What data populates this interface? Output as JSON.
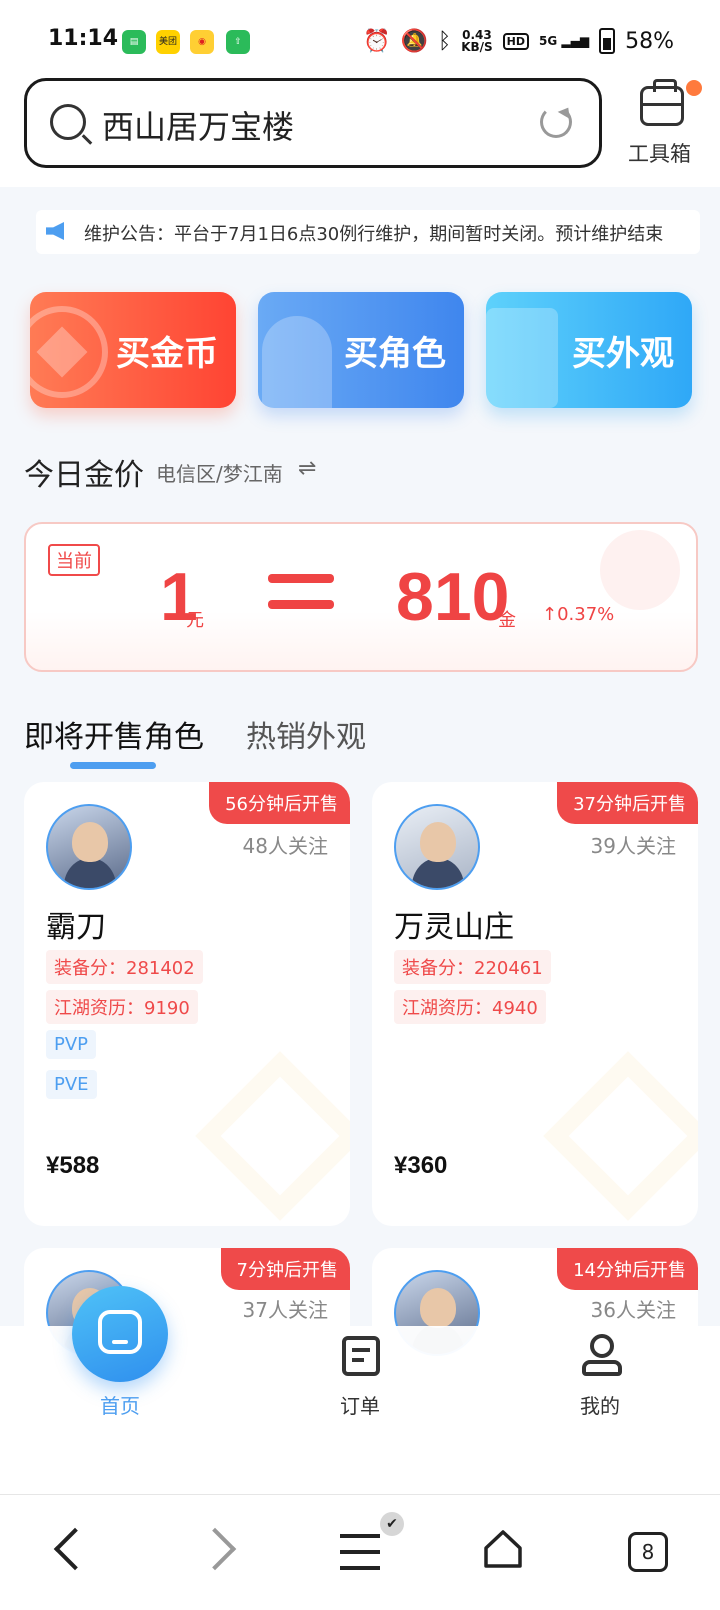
{
  "status_bar": {
    "time": "11:14",
    "network_speed": "0.43",
    "network_unit": "KB/S",
    "hd": "HD",
    "signal": "5G",
    "battery": "58%",
    "app_badges": [
      "美团"
    ]
  },
  "header": {
    "search_text": "西山居万宝楼",
    "toolbox_label": "工具箱"
  },
  "notice": {
    "text": "维护公告：平台于7月1日6点30例行维护，期间暂时关闭。预计维护结束"
  },
  "categories": [
    {
      "label": "买金币"
    },
    {
      "label": "买角色"
    },
    {
      "label": "买外观"
    }
  ],
  "gold_price": {
    "title": "今日金价",
    "region": "电信区/梦江南",
    "swap_icon": "⇌",
    "badge": "当前",
    "yuan_value": "1",
    "yuan_unit": "元",
    "gold_value": "810",
    "gold_unit": "金",
    "change": "↑0.37%"
  },
  "tabs": [
    {
      "label": "即将开售角色",
      "active": true
    },
    {
      "label": "热销外观",
      "active": false
    }
  ],
  "role_cards": [
    {
      "sale_tag": "56分钟后开售",
      "watchers": "48人关注",
      "name": "霸刀",
      "tags_red": [
        "装备分：281402",
        "江湖资历：9190"
      ],
      "tags_blue": [
        "PVP",
        "PVE"
      ],
      "price": "¥588"
    },
    {
      "sale_tag": "37分钟后开售",
      "watchers": "39人关注",
      "name": "万灵山庄",
      "tags_red": [
        "装备分：220461",
        "江湖资历：4940"
      ],
      "tags_blue": [],
      "price": "¥360"
    },
    {
      "sale_tag": "7分钟后开售",
      "watchers": "37人关注"
    },
    {
      "sale_tag": "14分钟后开售",
      "watchers": "36人关注"
    }
  ],
  "bottom_nav": [
    {
      "label": "首页",
      "icon": "home-icon",
      "active": true
    },
    {
      "label": "订单",
      "icon": "order-icon",
      "active": false
    },
    {
      "label": "我的",
      "icon": "profile-icon",
      "active": false
    }
  ],
  "system_nav": {
    "tab_count": "8",
    "menu_badge": "✔"
  },
  "colors": {
    "accent_blue": "#4d9ef0",
    "accent_red": "#ef4a4a",
    "gold_button": "#ff5a3c",
    "role_button": "#3f86ee",
    "skin_button": "#2fa8f7"
  }
}
